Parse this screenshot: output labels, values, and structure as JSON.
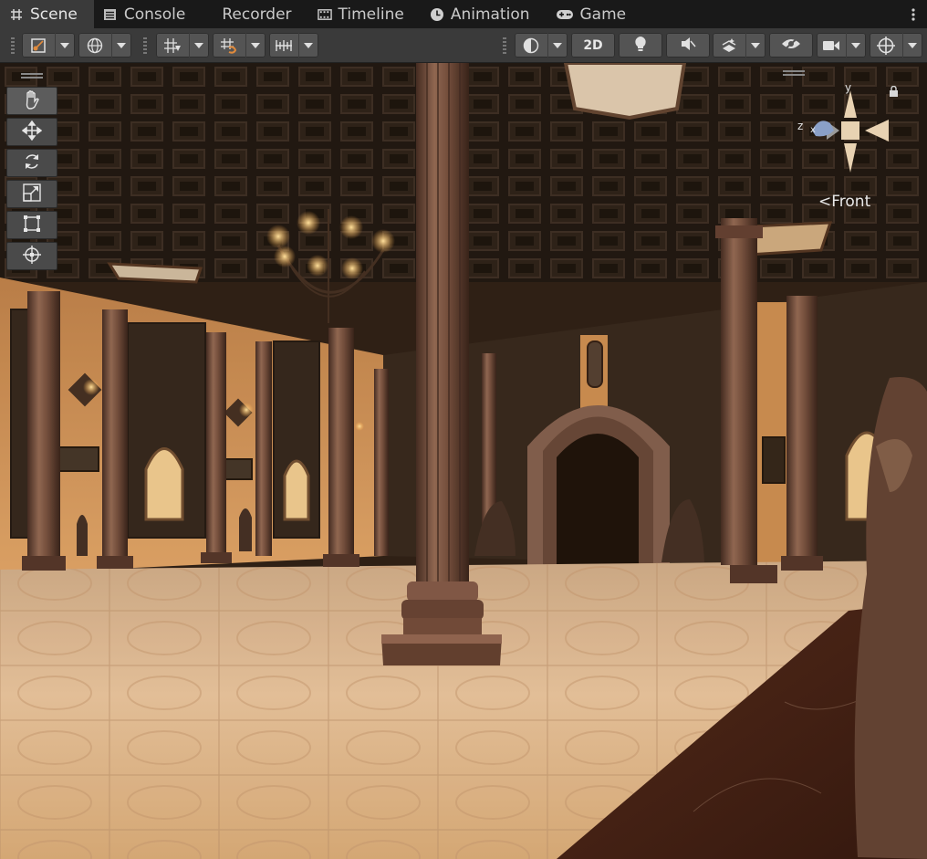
{
  "tabs": [
    {
      "label": "Scene",
      "icon": "grid-hash-icon",
      "active": true
    },
    {
      "label": "Console",
      "icon": "console-icon",
      "active": false
    },
    {
      "label": "Recorder",
      "icon": "",
      "active": false
    },
    {
      "label": "Timeline",
      "icon": "timeline-icon",
      "active": false
    },
    {
      "label": "Animation",
      "icon": "animation-clock-icon",
      "active": false
    },
    {
      "label": "Game",
      "icon": "gamepad-icon",
      "active": false
    }
  ],
  "toolbar": {
    "left": [
      "draw-mode-icon",
      "global-orientation-icon",
      "grid-snapping-icon",
      "increment-snap-icon",
      "ruler-snap-icon"
    ],
    "right": [
      "shading-mode-icon",
      "2d-toggle",
      "lighting-icon",
      "audio-icon",
      "effects-icon",
      "hidden-objects-icon",
      "camera-icon",
      "gizmos-icon"
    ],
    "two_d_label": "2D"
  },
  "tools": [
    "hand-tool-icon",
    "move-tool-icon",
    "rotate-tool-icon",
    "scale-tool-icon",
    "rect-tool-icon",
    "transform-tool-icon"
  ],
  "gizmo": {
    "y_label": "y",
    "z_label": "z",
    "x_label": "x",
    "view_label": "Front",
    "view_prefix": "<"
  },
  "colors": {
    "active_tab": "#3a3a3a",
    "toolbar": "#3a3a3a",
    "button": "#545454",
    "floor": "#d9b48f",
    "wall": "#d79a5e",
    "ceiling": "#1e1814",
    "column": "#6e4a3a"
  }
}
